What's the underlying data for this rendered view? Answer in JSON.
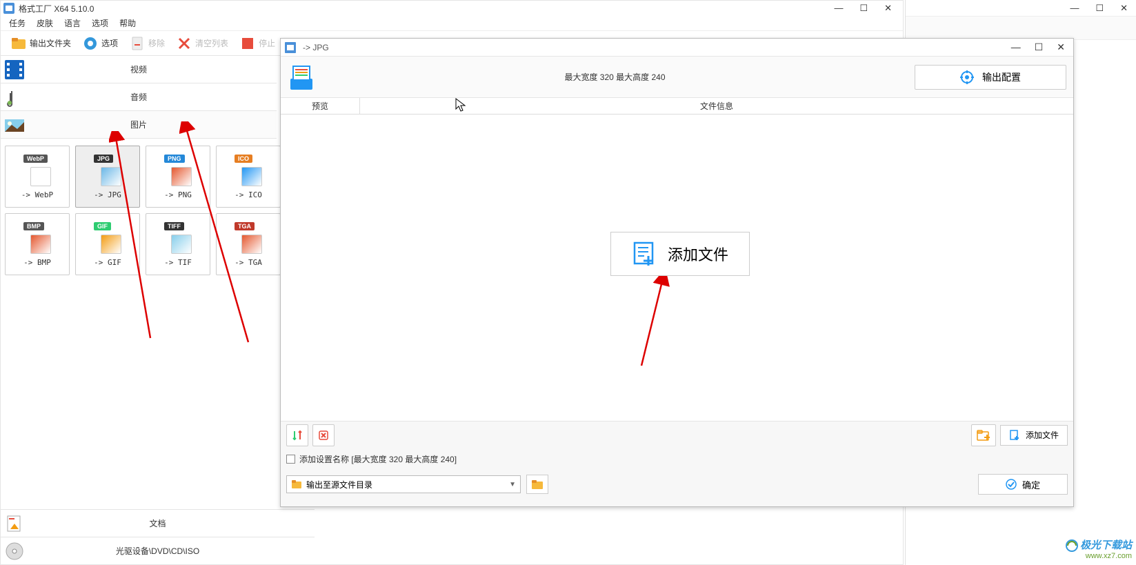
{
  "app": {
    "title": "格式工厂 X64 5.10.0"
  },
  "window_controls": {
    "min": "—",
    "max": "☐",
    "close": "✕"
  },
  "menu": [
    "任务",
    "皮肤",
    "语言",
    "选项",
    "帮助"
  ],
  "toolbar": {
    "output_folder": "输出文件夹",
    "options": "选项",
    "remove": "移除",
    "clear": "清空列表",
    "stop": "停止"
  },
  "categories": {
    "video": "视频",
    "audio": "音频",
    "image": "图片",
    "document": "文档",
    "optical": "光驱设备\\DVD\\CD\\ISO"
  },
  "formats": [
    {
      "badge": "WebP",
      "badge_color": "#555",
      "label": "-> WebP"
    },
    {
      "badge": "JPG",
      "badge_color": "#333",
      "label": "-> JPG",
      "selected": true
    },
    {
      "badge": "PNG",
      "badge_color": "#2488d8",
      "label": "-> PNG"
    },
    {
      "badge": "ICO",
      "badge_color": "#e67e22",
      "label": "-> ICO"
    },
    {
      "badge": "BMP",
      "badge_color": "#555",
      "label": "-> BMP"
    },
    {
      "badge": "GIF",
      "badge_color": "#2ecc71",
      "label": "-> GIF"
    },
    {
      "badge": "TIFF",
      "badge_color": "#333",
      "label": "-> TIF"
    },
    {
      "badge": "TGA",
      "badge_color": "#c0392b",
      "label": "-> TGA"
    }
  ],
  "dialog": {
    "title": "-> JPG",
    "size_info": "最大宽度 320 最大高度 240",
    "output_config": "输出配置",
    "col_preview": "预览",
    "col_fileinfo": "文件信息",
    "add_file_big": "添加文件",
    "add_file_btn": "添加文件",
    "add_settings_name": "添加设置名称 [最大宽度 320 最大高度 240]",
    "output_dest": "输出至源文件目录",
    "ok": "确定"
  },
  "watermark": {
    "text": "极光下载站",
    "url": "www.xz7.com"
  }
}
